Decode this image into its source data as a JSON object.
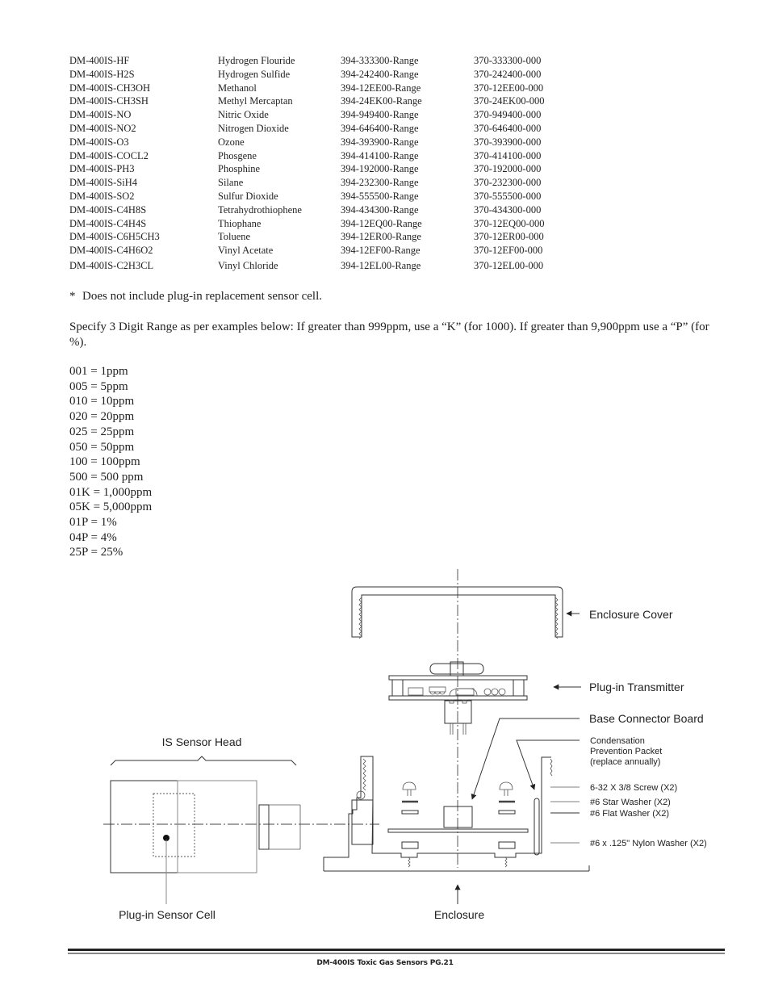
{
  "parts_table": {
    "rows": [
      [
        "DM-400IS-HF",
        "Hydrogen Flouride",
        "394-333300-Range",
        "370-333300-000"
      ],
      [
        "DM-400IS-H2S",
        "Hydrogen Sulfide",
        "394-242400-Range",
        "370-242400-000"
      ],
      [
        "DM-400IS-CH3OH",
        "Methanol",
        "394-12EE00-Range",
        "370-12EE00-000"
      ],
      [
        "DM-400IS-CH3SH",
        "Methyl Mercaptan",
        "394-24EK00-Range",
        "370-24EK00-000"
      ],
      [
        "DM-400IS-NO",
        "Nitric Oxide",
        "394-949400-Range",
        "370-949400-000"
      ],
      [
        "DM-400IS-NO2",
        "Nitrogen Dioxide",
        "394-646400-Range",
        "370-646400-000"
      ],
      [
        "DM-400IS-O3",
        "Ozone",
        "394-393900-Range",
        "370-393900-000"
      ],
      [
        "DM-400IS-COCL2",
        "Phosgene",
        "394-414100-Range",
        "370-414100-000"
      ],
      [
        "DM-400IS-PH3",
        "Phosphine",
        "394-192000-Range",
        "370-192000-000"
      ],
      [
        "DM-400IS-SiH4",
        "Silane",
        "394-232300-Range",
        "370-232300-000"
      ],
      [
        "DM-400IS-SO2",
        "Sulfur Dioxide",
        "394-555500-Range",
        "370-555500-000"
      ],
      [
        "DM-400IS-C4H8S",
        "Tetrahydrothiophene",
        "394-434300-Range",
        "370-434300-000"
      ],
      [
        "DM-400IS-C4H4S",
        "Thiophane",
        "394-12EQ00-Range",
        "370-12EQ00-000"
      ],
      [
        "DM-400IS-C6H5CH3",
        "Toluene",
        "394-12ER00-Range",
        "370-12ER00-000"
      ],
      [
        "DM-400IS-C4H6O2",
        "Vinyl Acetate",
        "394-12EF00-Range",
        "370-12EF00-000"
      ],
      [
        "DM-400IS-C2H3CL",
        "Vinyl Chloride",
        "394-12EL00-Range",
        "370-12EL00-000"
      ]
    ]
  },
  "footnote": {
    "marker": "*",
    "text": "Does not include plug-in replacement sensor cell."
  },
  "instructions": "Specify 3 Digit Range as per examples below: If greater than 999ppm, use a “K” (for 1000). If greater than 9,900ppm use a “P” (for %).",
  "range_examples": [
    "001 = 1ppm",
    "005 = 5ppm",
    "010 = 10ppm",
    "020 = 20ppm",
    "025 = 25ppm",
    "050 = 50ppm",
    "100 = 100ppm",
    "500 = 500 ppm",
    "01K = 1,000ppm",
    "05K = 5,000ppm",
    "01P = 1%",
    "04P = 4%",
    "25P = 25%"
  ],
  "diagram": {
    "labels": {
      "enclosure_cover": "Enclosure Cover",
      "plugin_transmitter": "Plug-in Transmitter",
      "base_connector_board": "Base Connector Board",
      "condensation_line1": "Condensation",
      "condensation_line2": "Prevention Packet",
      "condensation_line3": "(replace annually)",
      "screw": "6-32 X 3/8 Screw (X2)",
      "star_washer": "#6 Star Washer (X2)",
      "flat_washer": "#6 Flat Washer (X2)",
      "nylon_washer": "#6 x .125\" Nylon Washer (X2)",
      "is_sensor_head": "IS Sensor Head",
      "plugin_sensor_cell": "Plug-in Sensor Cell",
      "enclosure": "Enclosure"
    }
  },
  "footer": {
    "text": "DM-400IS Toxic Gas Sensors   PG.21"
  }
}
